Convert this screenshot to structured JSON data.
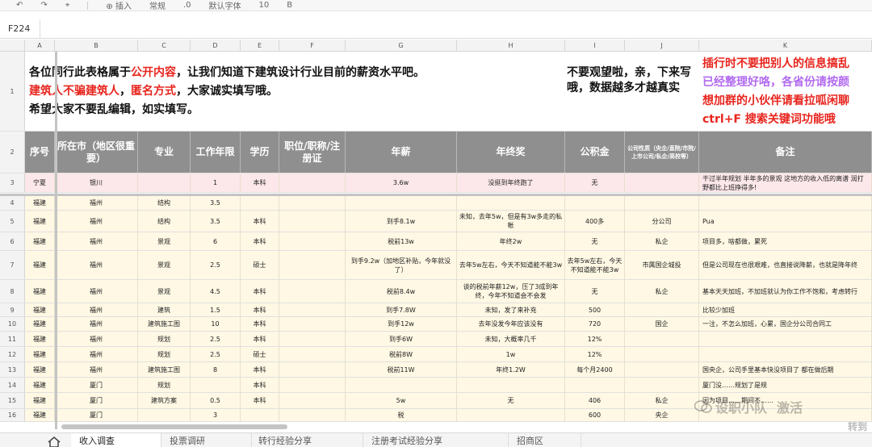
{
  "toolbar": {
    "insert_label": "插入",
    "style_label": "常规",
    "decimal_label": ".0",
    "font_label": "默认字体",
    "size_label": "10",
    "bold_label": "B"
  },
  "formula_bar": {
    "cell_ref": "F224"
  },
  "columns": [
    "A",
    "B",
    "C",
    "D",
    "E",
    "F",
    "G",
    "H",
    "I",
    "J",
    "K"
  ],
  "notice": {
    "line1_pre": "各位同行此表格属于",
    "line1_red": "公开内容",
    "line1_post": "，让我们知道下建筑设计行业目前的薪资水平吧。",
    "line2_red1": "建筑人不骗建筑人",
    "line2_mid": "，",
    "line2_red2": "匿名方式",
    "line2_post": "，大家诚实填写哦。",
    "line3": "希望大家不要乱编辑，如实填写。",
    "mid_text": "不要观望啦，亲，下来写哦，数据越多才越真实",
    "right1": "插行时不要把别人的信息搞乱",
    "right2": "已经整理好咯，各省份请按颜",
    "right3": "想加群的小伙伴请看拉呱闲聊",
    "right4": "ctrl+F 搜索关键词功能哦"
  },
  "headers": [
    "序号",
    "所在市（地区很重要）",
    "专业",
    "工作年限",
    "学历",
    "职位/职称/注册证",
    "年薪",
    "年终奖",
    "公积金",
    "公司性质（央企/直院/市院/上市公司/私企/高校等）",
    "备注"
  ],
  "rows": [
    {
      "n": "3",
      "cells": [
        "宁夏",
        "银川",
        "",
        "1",
        "本科",
        "",
        "3.6w",
        "没挺到年终跑了",
        "无",
        "",
        "干过半年规划 半年多的景观 这地方的收入低的离谱 润打野都比上班挣得多!"
      ]
    },
    {
      "n": "4",
      "cells": [
        "福建",
        "福州",
        "结构",
        "3.5",
        "",
        "",
        "",
        "",
        "",
        "",
        ""
      ]
    },
    {
      "n": "5",
      "cells": [
        "福建",
        "福州",
        "结构",
        "3.5",
        "本科",
        "",
        "到手8.1w",
        "未知，去年5w，但是有3w多走的私帐",
        "400多",
        "分公司",
        "Pua"
      ]
    },
    {
      "n": "6",
      "cells": [
        "福建",
        "福州",
        "景观",
        "6",
        "本科",
        "",
        "税前13w",
        "年终2w",
        "无",
        "私企",
        "项目多，啥都做，累死"
      ]
    },
    {
      "n": "7",
      "cells": [
        "福建",
        "福州",
        "景观",
        "2.5",
        "硕士",
        "",
        "到手9.2w（加地区补贴，今年就没了）",
        "去年5w左右，今天不知道能不能3w",
        "去年5w左右，今天不知道能不能3w",
        "市属国企城投",
        "但是公司现在也很艰难，也直接说降薪，也就是降年终"
      ]
    },
    {
      "n": "8",
      "cells": [
        "福建",
        "福州",
        "景观",
        "4.5",
        "本科",
        "",
        "税前8.4w",
        "谈的税前年薪12w，压了3成到年终，今年不知道会不会发",
        "无",
        "私企",
        "基本天天加班，不加班就认为你工作不饱和，考虑转行"
      ]
    },
    {
      "n": "9",
      "cells": [
        "福建",
        "福州",
        "建筑",
        "1.5",
        "本科",
        "",
        "到手7.8W",
        "未知，发了来补充",
        "500",
        "",
        "比较少加班"
      ]
    },
    {
      "n": "10",
      "cells": [
        "福建",
        "福州",
        "建筑施工图",
        "10",
        "本科",
        "",
        "到手12w",
        "去年没发今年应该没有",
        "720",
        "国企",
        "一注，不怎么加班，心累，国企分公司合同工"
      ]
    },
    {
      "n": "11",
      "cells": [
        "福建",
        "福州",
        "规划",
        "2.5",
        "本科",
        "",
        "到手6W",
        "未知，大概率几千",
        "12%",
        "",
        ""
      ]
    },
    {
      "n": "12",
      "cells": [
        "福建",
        "福州",
        "规划",
        "2.5",
        "硕士",
        "",
        "税前8W",
        "1w",
        "12%",
        "",
        ""
      ]
    },
    {
      "n": "13",
      "cells": [
        "福建",
        "福州",
        "建筑施工图",
        "8",
        "本科",
        "",
        "税前11W",
        "年终1.2W",
        "每个月2400",
        "",
        "国央企，公司手里基本快没项目了 都在做后期"
      ]
    },
    {
      "n": "14",
      "cells": [
        "福建",
        "厦门",
        "规划",
        "",
        "本科",
        "",
        "",
        "",
        "",
        "",
        "厦门没……规划了是规"
      ]
    },
    {
      "n": "15",
      "cells": [
        "福建",
        "厦门",
        "建筑方案",
        "0.5",
        "本科",
        "",
        "5w",
        "无",
        "406",
        "私企",
        "因为项目……期间不……"
      ]
    },
    {
      "n": "16",
      "cells": [
        "福建",
        "厦门",
        "",
        "3",
        "",
        "",
        "税",
        "",
        "600",
        "央企",
        ""
      ]
    }
  ],
  "sheet_tabs": [
    "收入调查",
    "投票调研",
    "转行经验分享",
    "注册考试经验分享",
    "招商区"
  ],
  "watermark": {
    "text": "设职小队",
    "suffix": "激活",
    "sub": "转到"
  }
}
